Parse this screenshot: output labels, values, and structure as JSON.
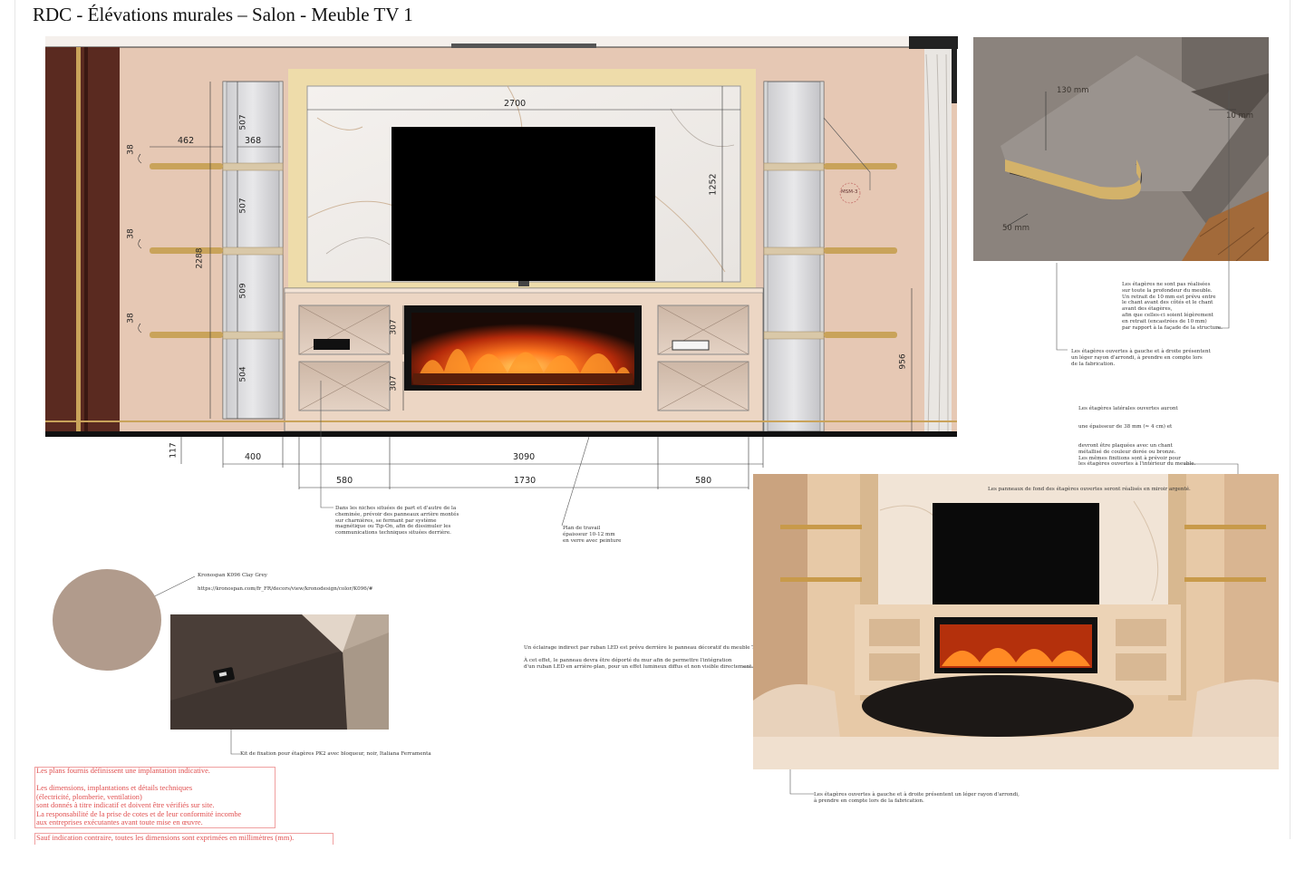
{
  "title": "RDC - Élévations murales – Salon - Meuble TV 1",
  "dimensions": {
    "tv_panel_width": "2700",
    "tv_panel_height": "1252",
    "shelf_thickness": [
      "38",
      "38",
      "38"
    ],
    "shelf_depth_left": "462",
    "shelf_inner_width": "368",
    "bay_heights": [
      "507",
      "507",
      "509",
      "504"
    ],
    "total_height": "2288",
    "niche_height_top": "307",
    "niche_height_bottom": "307",
    "console_height": "956",
    "plinth": "117",
    "width_side": "400",
    "width_total": "3090",
    "width_niche_left": "580",
    "width_fireplace": "1730",
    "width_niche_right": "580"
  },
  "tags": {
    "msm": "MSM-3"
  },
  "detail_3d": {
    "label_130": "130 mm",
    "label_10": "10 mm",
    "label_50": "50 mm"
  },
  "notes": {
    "shelves_not_full_depth": "Les étagères ne sont pas réalisées\nsur toute la profondeur du meuble.\nUn retrait de 10 mm est prévu entre\nle chant avant des côtés et le chant\navant des étagères,\nafin que celles-ci soient légèrement\nen retrait (encastrées de 10 mm)\npar rapport à la façade de la structure.",
    "rounded_shelves": "Les étagères ouvertes à gauche et à droite présentent\nun léger rayon d'arrondi, à prendre en compte lors\nde la fabrication.",
    "side_shelves_1": "Les étagères latérales ouvertes auront",
    "side_shelves_2": "une épaisseur de 38 mm (≈ 4 cm) et",
    "side_shelves_3": "devront être plaquées avec un chant\nmétallisé de couleur dorée ou bronze.\nLes mêmes finitions sont à prévoir pour\nles étagères ouvertes à l'intérieur du meuble.",
    "mirror_panels": "Les panneaux de fond des étagères ouvertes seront réalisés en miroir argenté.",
    "niches_panels": "Dans les niches situées de part et d'autre de la\ncheminée, prévoir des panneaux arrière montés\nsur charnières, se fermant par système\nmagnétique ou Tip-On, afin de dissimuler les\ncommunications techniques situées derrière.",
    "worktop": "Plan de travail\népaisseur 10-12 mm\nen verre avec peinture",
    "kronospan_name": "Kronospan K096 Clay Grey",
    "kronospan_url": "https://kronospan.com/fr_FR/decors/view/kronodesign/color/K096/#",
    "led_1": "Un éclairage indirect par ruban LED est prévu derrière le panneau décoratif du meuble TV.",
    "led_2": "À cet effet, le panneau devra être déporté du mur afin de permettre l'intégration\nd'un ruban LED en arrière-plan, pour un effet lumineux diffus et non visible directement.",
    "kit": "Kit de fixation pour étagères PK2 avec bloqueur, noir, Italiana Ferramenta",
    "rounded_shelves_bottom": "Les étagères ouvertes à gauche et à droite présentent un léger rayon d'arrondi,\nà prendre en compte lors de la fabrication."
  },
  "disclaimer": {
    "line1": "Les plans fournis définissent une implantation indicative.",
    "line2": "Les dimensions, implantations et détails techniques\n(électricité, plomberie, ventilation)\nsont donnés à titre indicatif et doivent être vérifiés sur site.\nLa responsabilité de la prise de cotes et de leur conformité incombe\naux entreprises exécutantes avant toute mise en œuvre.",
    "line3": "Sauf indication contraire, toutes les dimensions sont exprimées en millimètres (mm)."
  },
  "colors": {
    "wall": "#e6c8b4",
    "wood_dark": "#5a2a20",
    "gold": "#c9a35a",
    "swatch": "#b19b8c",
    "disclaimer": "#e05050"
  }
}
